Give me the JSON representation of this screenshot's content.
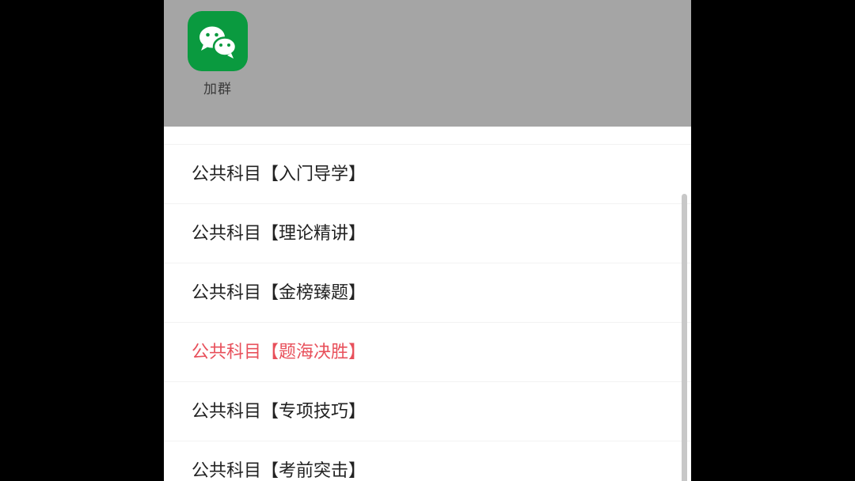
{
  "share_panel": {
    "app": {
      "icon": "wechat-icon",
      "label": "加群",
      "color": "#0a9a3f"
    }
  },
  "course_menu": {
    "items": [
      {
        "label": "公共科目【入门导学】",
        "active": false
      },
      {
        "label": "公共科目【理论精讲】",
        "active": false
      },
      {
        "label": "公共科目【金榜臻题】",
        "active": false
      },
      {
        "label": "公共科目【题海决胜】",
        "active": true
      },
      {
        "label": "公共科目【专项技巧】",
        "active": false
      },
      {
        "label": "公共科目【考前突击】",
        "active": false
      }
    ],
    "active_color": "#e8505b"
  }
}
